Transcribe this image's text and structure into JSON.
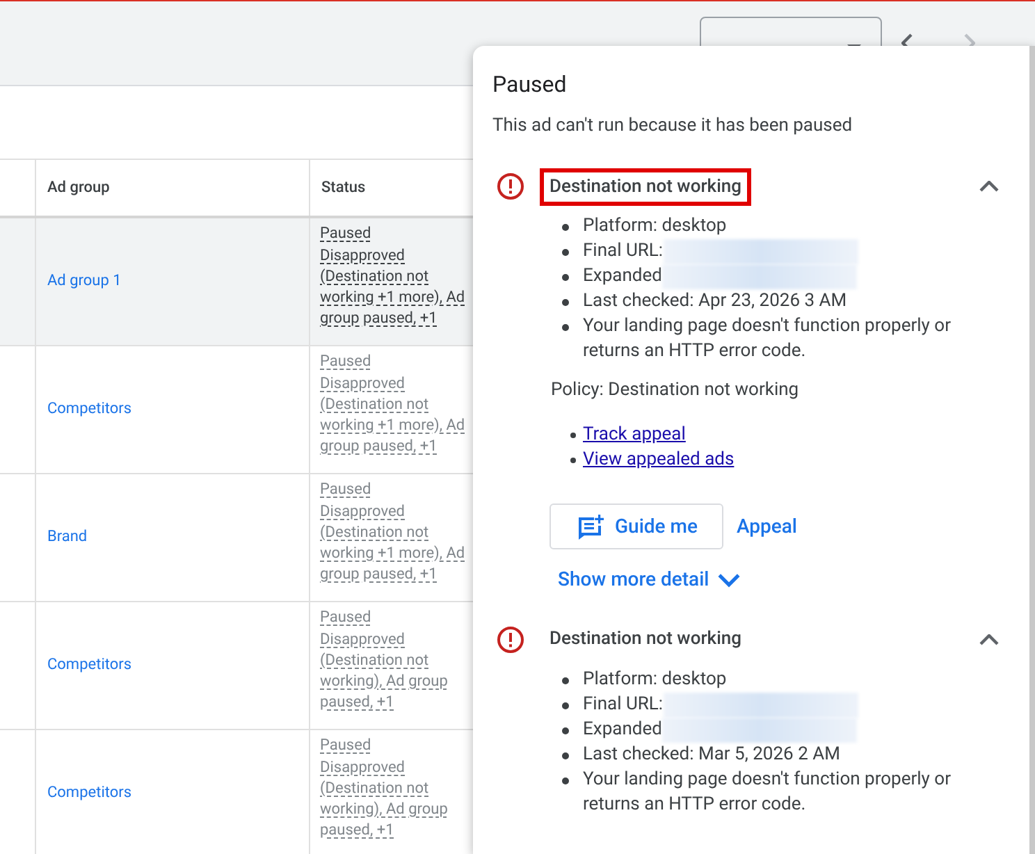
{
  "table": {
    "columns": [
      "Ad group",
      "Status"
    ],
    "rows": [
      {
        "ad_group": "Ad group 1",
        "status": "Paused",
        "detail": "Disapproved (Destination not working +1 more), Ad group paused, +1",
        "highlighted": true
      },
      {
        "ad_group": "Competitors",
        "status": "Paused",
        "detail": "Disapproved (Destination not working +1 more), Ad group paused, +1",
        "highlighted": false
      },
      {
        "ad_group": "Brand",
        "status": "Paused",
        "detail": "Disapproved (Destination not working +1 more), Ad group paused, +1",
        "highlighted": false
      },
      {
        "ad_group": "Competitors",
        "status": "Paused",
        "detail": "Disapproved (Destination not working), Ad group paused, +1",
        "highlighted": false
      },
      {
        "ad_group": "Competitors",
        "status": "Paused",
        "detail": "Disapproved (Destination not working), Ad group paused, +1",
        "highlighted": false
      }
    ]
  },
  "popup": {
    "title": "Paused",
    "description": "This ad can't run because it has been paused",
    "issues": [
      {
        "title": "Destination not working",
        "highlighted": true,
        "expanded": true,
        "details": [
          {
            "kind": "text",
            "text": "Platform: desktop"
          },
          {
            "kind": "redacted",
            "text": "Final URL:"
          },
          {
            "kind": "redacted",
            "text": "Expanded"
          },
          {
            "kind": "text",
            "text": "Last checked: Apr 23, 2026 3 AM"
          },
          {
            "kind": "text",
            "text": "Your landing page doesn't function properly or returns an HTTP error code."
          }
        ],
        "policy": "Policy: Destination not working",
        "links": [
          "Track appeal",
          "View appealed ads"
        ],
        "guide_button": "Guide me",
        "appeal_link": "Appeal",
        "show_more": "Show more detail"
      },
      {
        "title": "Destination not working",
        "highlighted": false,
        "expanded": true,
        "details": [
          {
            "kind": "text",
            "text": "Platform: desktop"
          },
          {
            "kind": "redacted",
            "text": "Final URL:"
          },
          {
            "kind": "redacted",
            "text": "Expanded"
          },
          {
            "kind": "text",
            "text": "Last checked: Mar 5, 2026 2 AM"
          },
          {
            "kind": "text",
            "text": "Your landing page doesn't function properly or returns an HTTP error code."
          }
        ]
      }
    ]
  }
}
